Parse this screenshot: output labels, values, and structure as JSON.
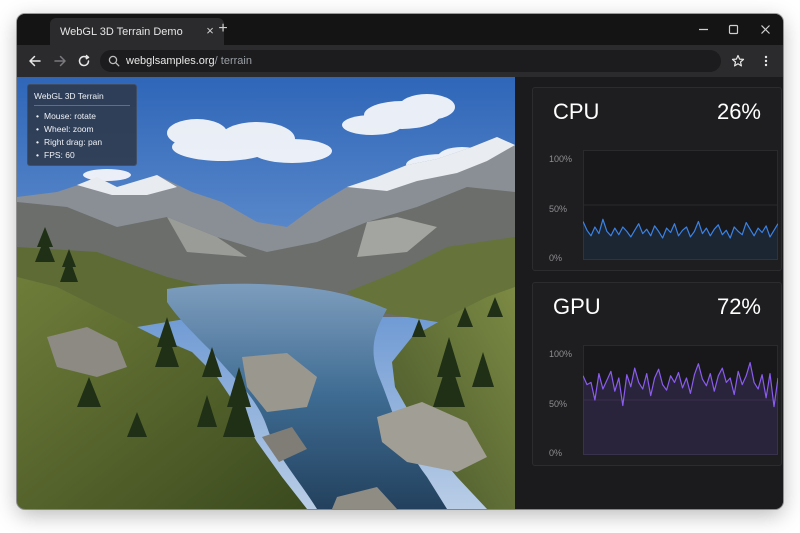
{
  "browser": {
    "tab_title": "WebGL 3D Terrain Demo",
    "tab_close": "×",
    "new_tab": "+",
    "url_host": "webglsamples.org",
    "url_path": " / terrain"
  },
  "icons": {
    "back": "arrow-left-icon",
    "forward": "arrow-right-icon",
    "reload": "reload-icon",
    "search": "search-icon",
    "star": "star-icon",
    "menu": "kebab-menu-icon",
    "minimize": "minimize-icon",
    "maximize": "maximize-icon",
    "close": "close-icon"
  },
  "info_box": {
    "title": "WebGL 3D Terrain",
    "items": [
      "Mouse: rotate",
      "Wheel: zoom",
      "Right drag: pan",
      "FPS: 60"
    ]
  },
  "monitors": [
    {
      "name": "CPU",
      "value": "26%",
      "ticks": [
        "100%",
        "50%",
        "0%"
      ],
      "color": "#3a82e6",
      "samples": [
        35,
        27,
        22,
        30,
        24,
        37,
        26,
        22,
        29,
        23,
        30,
        26,
        21,
        27,
        33,
        24,
        28,
        22,
        31,
        26,
        20,
        29,
        25,
        33,
        22,
        27,
        30,
        21,
        26,
        35,
        24,
        29,
        22,
        28,
        32,
        23,
        27,
        20,
        30,
        26,
        23,
        34,
        28,
        22,
        29,
        25,
        31,
        21,
        27,
        33
      ]
    },
    {
      "name": "GPU",
      "value": "72%",
      "ticks": [
        "100%",
        "50%",
        "0%"
      ],
      "color": "#8a5cf0",
      "samples": [
        72,
        64,
        66,
        50,
        74,
        60,
        68,
        76,
        58,
        70,
        45,
        73,
        62,
        79,
        66,
        60,
        74,
        54,
        70,
        78,
        64,
        59,
        72,
        66,
        75,
        61,
        70,
        56,
        73,
        83,
        69,
        63,
        74,
        58,
        72,
        79,
        66,
        70,
        55,
        76,
        64,
        72,
        84,
        66,
        60,
        73,
        52,
        74,
        44,
        70
      ]
    }
  ]
}
